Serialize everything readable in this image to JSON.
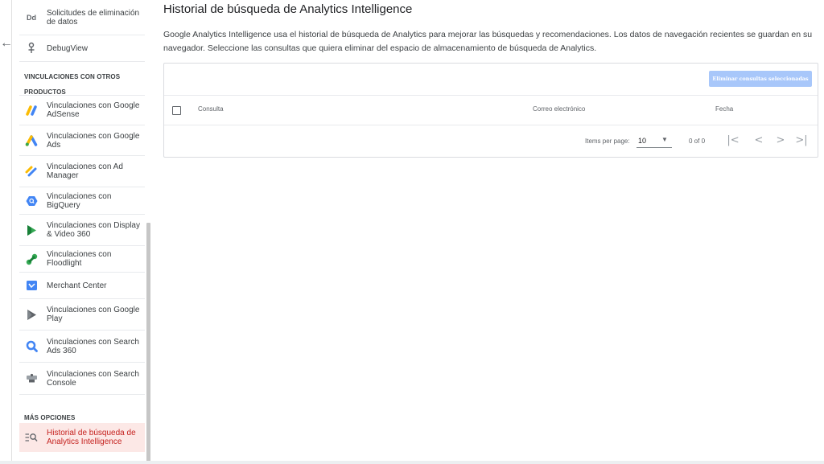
{
  "sidebar": {
    "items_top": [
      {
        "label": "Solicitudes de eliminación de datos",
        "icon": "dd-icon"
      },
      {
        "label": "DebugView",
        "icon": "debug-icon"
      }
    ],
    "section_links": "VINCULACIONES CON OTROS PRODUCTOS",
    "links": [
      {
        "label": "Vinculaciones con Google AdSense",
        "icon": "adsense-icon"
      },
      {
        "label": "Vinculaciones con Google Ads",
        "icon": "google-ads-icon"
      },
      {
        "label": "Vinculaciones con Ad Manager",
        "icon": "ad-manager-icon"
      },
      {
        "label": "Vinculaciones con BigQuery",
        "icon": "bigquery-icon"
      },
      {
        "label": "Vinculaciones con Display & Video 360",
        "icon": "display-video-icon"
      },
      {
        "label": "Vinculaciones con Floodlight",
        "icon": "floodlight-icon"
      },
      {
        "label": "Merchant Center",
        "icon": "merchant-center-icon"
      },
      {
        "label": "Vinculaciones con Google Play",
        "icon": "google-play-icon"
      },
      {
        "label": "Vinculaciones con Search Ads 360",
        "icon": "search-ads-icon"
      },
      {
        "label": "Vinculaciones con Search Console",
        "icon": "search-console-icon"
      }
    ],
    "section_more": "MÁS OPCIONES",
    "active_item": {
      "label": "Historial de búsqueda de Analytics Intelligence",
      "icon": "search-history-icon"
    }
  },
  "main": {
    "title": "Historial de búsqueda de Analytics Intelligence",
    "description": "Google Analytics Intelligence usa el historial de búsqueda de Analytics para mejorar las búsquedas y recomendaciones. Los datos de navegación recientes se guardan en su navegador. Seleccione las consultas que quiera eliminar del espacio de almacenamiento de búsqueda de Analytics.",
    "delete_button": "Eliminar consultas seleccionadas",
    "columns": [
      "Consulta",
      "Correo electrónico",
      "Fecha"
    ],
    "rows": [],
    "pager": {
      "items_per_page_label": "Items per page:",
      "items_per_page": "10",
      "range": "0 of 0"
    }
  },
  "colors": {
    "active": "#c5221f",
    "active_bg": "#fce8e6",
    "button_disabled": "#a8c7fa"
  }
}
